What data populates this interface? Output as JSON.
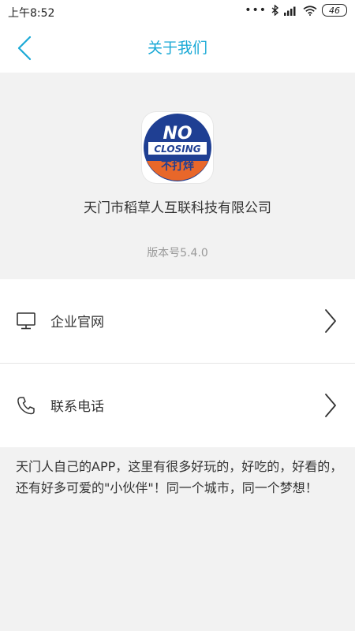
{
  "status_bar": {
    "time": "上午8:52",
    "battery": "46"
  },
  "nav": {
    "title": "关于我们",
    "back_icon": "chevron-left-icon"
  },
  "header": {
    "logo_texts": [
      "NO",
      "CLOSING",
      "不打烊"
    ],
    "company_name": "天门市稻草人互联科技有限公司",
    "version": "版本号5.4.0"
  },
  "menu": [
    {
      "label": "企业官网",
      "icon": "monitor-icon"
    },
    {
      "label": "联系电话",
      "icon": "phone-icon"
    }
  ],
  "about_text": "天门人自己的APP，这里有很多好玩的，好吃的，好看的，还有好多可爱的\"小伙伴\"！同一个城市，同一个梦想！",
  "colors": {
    "accent": "#1aa9d6",
    "logo_blue": "#1f3f93",
    "logo_orange": "#e8672a",
    "background": "#f2f2f2"
  }
}
